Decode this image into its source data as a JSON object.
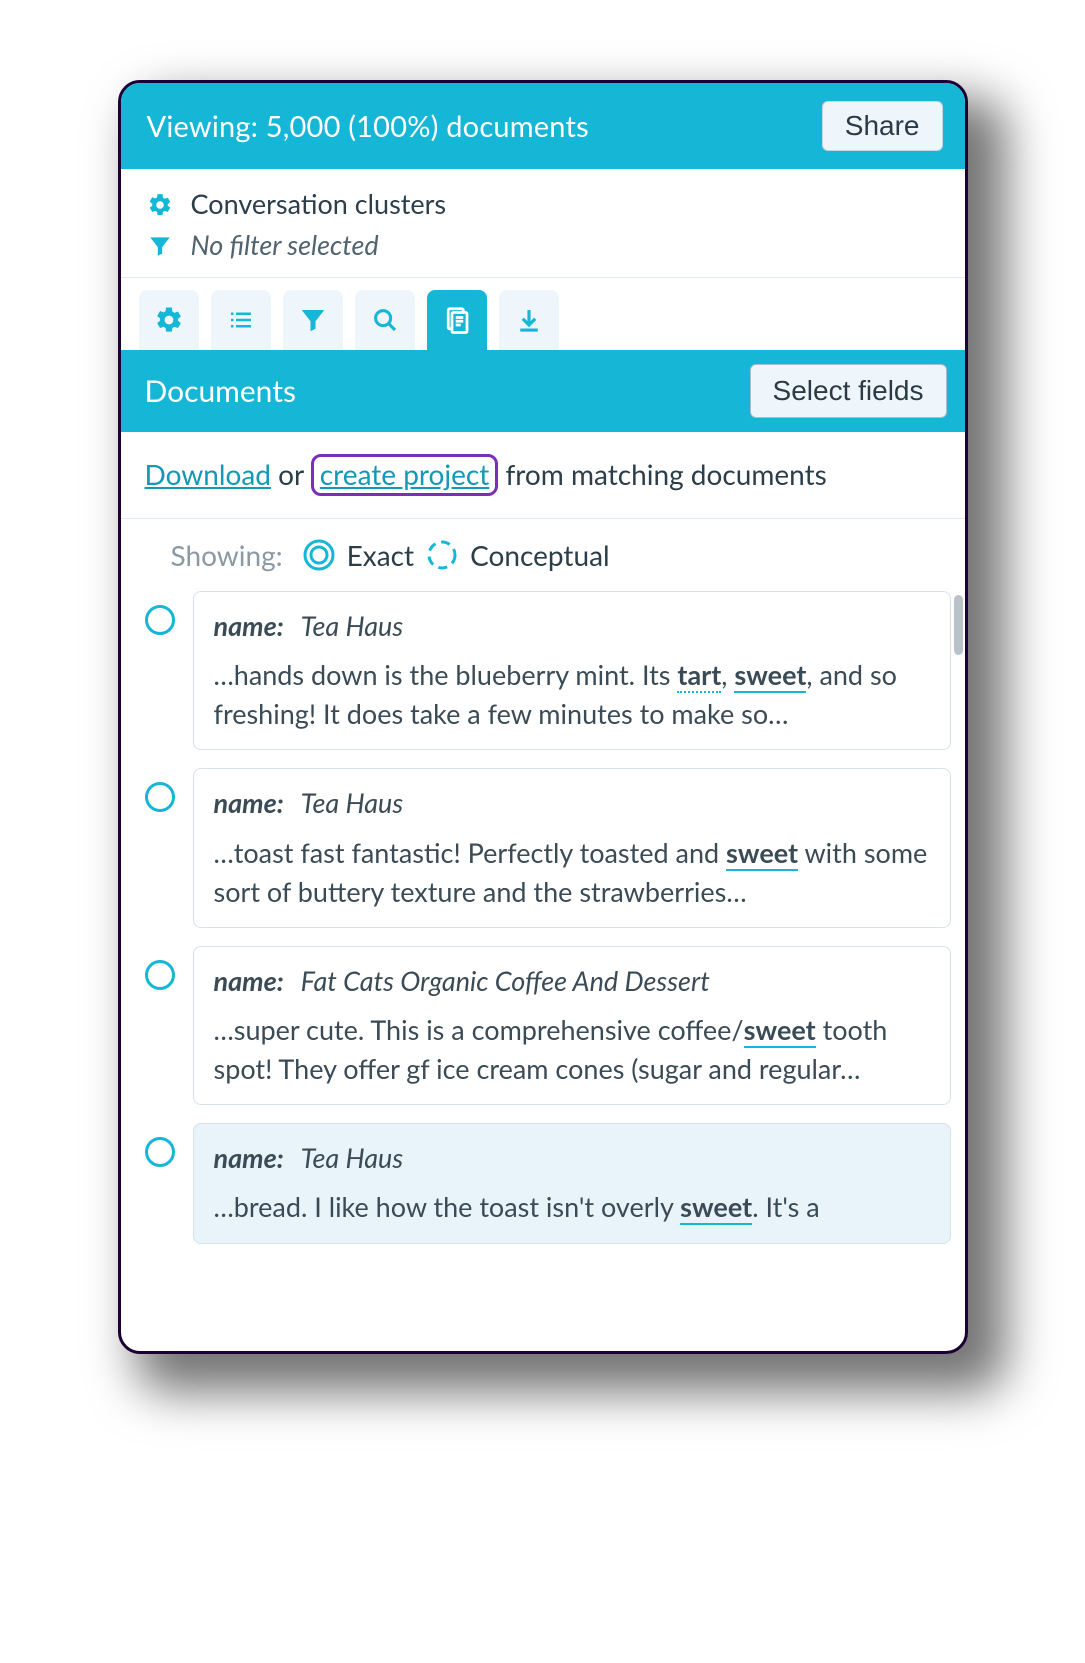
{
  "header": {
    "status": "Viewing: 5,000 (100%) documents",
    "share_label": "Share"
  },
  "filters": {
    "clusters_label": "Conversation clusters",
    "no_filter_label": "No filter selected"
  },
  "documents_bar": {
    "title": "Documents",
    "select_fields_label": "Select fields"
  },
  "action_line": {
    "download": "Download",
    "or": " or ",
    "create_project": "create project",
    "suffix": " from matching documents"
  },
  "showing": {
    "label": "Showing:",
    "exact": "Exact",
    "conceptual": "Conceptual"
  },
  "name_label": "name:",
  "docs": [
    {
      "name": "Tea Haus",
      "snippet_pre": "…hands down is the blueberry mint. Its ",
      "kw1": "tart",
      "mid1": ", ",
      "kw2": "sweet",
      "snippet_post": ", and so freshing! It does take a few minutes to make so…"
    },
    {
      "name": "Tea Haus",
      "snippet_pre": "…toast fast fantastic! Perfectly toasted and ",
      "kw1": "sweet",
      "snippet_post": " with some sort of buttery texture and the strawberries…"
    },
    {
      "name": "Fat Cats Organic Coffee And Dessert",
      "snippet_pre": "…super cute. This is a comprehensive coffee/",
      "kw1": "sweet",
      "snippet_post": " tooth spot! They offer gf ice cream cones (sugar and regular…"
    },
    {
      "name": "Tea Haus",
      "snippet_pre": "…bread. I like how the toast isn't overly ",
      "kw1": "sweet",
      "snippet_post": ". It's a"
    }
  ]
}
